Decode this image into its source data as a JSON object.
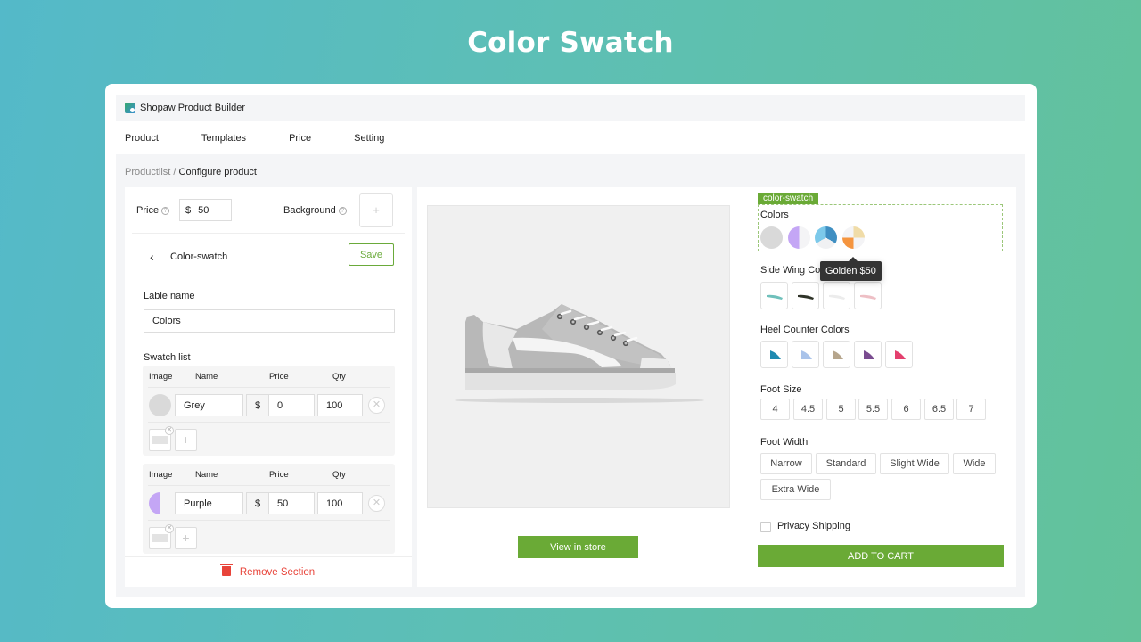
{
  "hero": {
    "title": "Color Swatch"
  },
  "app": {
    "title": "Shopaw Product Builder"
  },
  "nav": {
    "items": [
      "Product",
      "Templates",
      "Price",
      "Setting"
    ]
  },
  "breadcrumb": {
    "parent": "Productlist",
    "separator": "/",
    "current": "Configure product"
  },
  "left_panel": {
    "price_label": "Price",
    "price_currency": "$",
    "price_value": "50",
    "background_label": "Background",
    "help_icon": "?",
    "add_icon": "+",
    "section_name": "Color-swatch",
    "save_label": "Save",
    "label_name_title": "Lable name",
    "label_name_value": "Colors",
    "swatch_list_title": "Swatch list",
    "columns": [
      "Image",
      "Name",
      "Price",
      "Qty"
    ],
    "swatches": [
      {
        "name": "Grey",
        "currency": "$",
        "price": "0",
        "qty": "100",
        "color": "#d9d9d9"
      },
      {
        "name": "Purple",
        "currency": "$",
        "price": "50",
        "qty": "100",
        "color": "#c4a6f5"
      }
    ],
    "remove_section_label": "Remove Section"
  },
  "preview": {
    "view_in_store_label": "View in store"
  },
  "options": {
    "tag": "color-swatch",
    "colors_title": "Colors",
    "color_circles": [
      {
        "name": "Grey",
        "colors": [
          "#d9d9d9"
        ]
      },
      {
        "name": "Purple",
        "colors": [
          "#c4a6f5",
          "#f4f4f6"
        ]
      },
      {
        "name": "Blue",
        "colors": [
          "#7cc9ea",
          "#3f8fc2",
          "#f0f1f3"
        ]
      },
      {
        "name": "Golden",
        "colors": [
          "#f0dca8",
          "#f4f4f6",
          "#f5953f",
          "#f4f4f6"
        ]
      }
    ],
    "tooltip": "Golden $50",
    "side_wing_title": "Side Wing Colors",
    "side_wing_colors": [
      "#6fc0bb",
      "#2f3328",
      "#ececec",
      "#eebfc5"
    ],
    "heel_counter_title": "Heel Counter Colors",
    "heel_counter_colors": [
      "#1f8ab0",
      "#a9c3ea",
      "#b6a58c",
      "#7a4c90",
      "#e4406e"
    ],
    "foot_size_title": "Foot Size",
    "foot_sizes": [
      "4",
      "4.5",
      "5",
      "5.5",
      "6",
      "6.5",
      "7"
    ],
    "foot_width_title": "Foot Width",
    "foot_widths": [
      "Narrow",
      "Standard",
      "Slight Wide",
      "Wide",
      "Extra Wide"
    ],
    "privacy_label": "Privacy Shipping",
    "add_to_cart_label": "ADD TO CART"
  },
  "colors": {
    "accent_green": "#6aaa36",
    "danger_red": "#e8443a"
  }
}
